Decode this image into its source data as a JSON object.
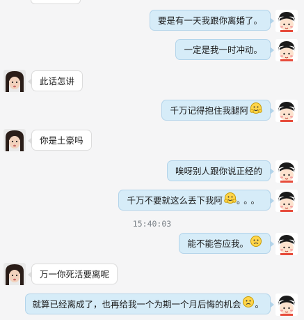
{
  "conversation": {
    "messages": [
      {
        "side": "me",
        "text": "要是有一天我跟你离婚了。",
        "emoji": ""
      },
      {
        "side": "me",
        "text": "一定是我一时冲动。",
        "emoji": ""
      },
      {
        "side": "other",
        "text": "此话怎讲",
        "emoji": ""
      },
      {
        "side": "me",
        "text": "千万记得抱住我腿阿",
        "emoji": "hug-emoji"
      },
      {
        "side": "other",
        "text": "你是土豪吗",
        "emoji": ""
      },
      {
        "side": "me",
        "text": "唉呀别人跟你说正经的",
        "emoji": ""
      },
      {
        "side": "me",
        "text": "千万不要就这么丢下我阿",
        "emoji": "hug-emoji",
        "suffix": "。。。"
      },
      {
        "side": "me",
        "text": "能不能答应我。",
        "emoji": "sad-emoji"
      },
      {
        "side": "other",
        "text": "万一你死活要离呢",
        "emoji": ""
      },
      {
        "side": "me",
        "text": "就算已经离成了，也再给我一个为期一个月后悔的机会",
        "emoji": "sad-emoji",
        "suffix": "。"
      }
    ],
    "timestamp": "15:40:03"
  }
}
